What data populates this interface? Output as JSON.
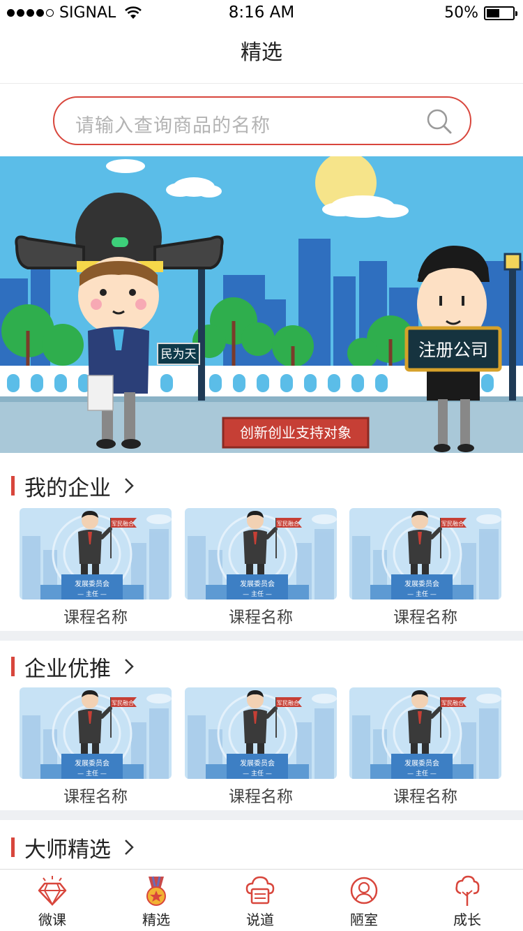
{
  "status": {
    "carrier": "SIGNAL",
    "time": "8:16 AM",
    "battery": "50%",
    "battery_level": 0.5
  },
  "nav": {
    "title": "精选"
  },
  "search": {
    "placeholder": "请输入查询商品的名称"
  },
  "banner": {
    "sign_left": "民为天",
    "sign_right": "注册公司",
    "caption": "创新创业支持对象"
  },
  "sections": [
    {
      "title": "我的企业",
      "items": [
        {
          "label": "课程名称",
          "flag": "军民融合",
          "podium_line1": "发展委员会",
          "podium_line2": "— 主任 —"
        },
        {
          "label": "课程名称",
          "flag": "军民融合",
          "podium_line1": "发展委员会",
          "podium_line2": "— 主任 —"
        },
        {
          "label": "课程名称",
          "flag": "军民融合",
          "podium_line1": "发展委员会",
          "podium_line2": "— 主任 —"
        }
      ]
    },
    {
      "title": "企业优推",
      "items": [
        {
          "label": "课程名称",
          "flag": "军民融合",
          "podium_line1": "发展委员会",
          "podium_line2": "— 主任 —"
        },
        {
          "label": "课程名称",
          "flag": "军民融合",
          "podium_line1": "发展委员会",
          "podium_line2": "— 主任 —"
        },
        {
          "label": "课程名称",
          "flag": "军民融合",
          "podium_line1": "发展委员会",
          "podium_line2": "— 主任 —"
        }
      ]
    },
    {
      "title": "大师精选"
    }
  ],
  "tabs": [
    {
      "label": "微课",
      "icon": "diamond-icon"
    },
    {
      "label": "精选",
      "icon": "medal-icon"
    },
    {
      "label": "说道",
      "icon": "cloud-message-icon"
    },
    {
      "label": "陋室",
      "icon": "person-icon"
    },
    {
      "label": "成长",
      "icon": "tree-icon"
    }
  ],
  "colors": {
    "accent": "#d8463c",
    "sky": "#5bbde8",
    "divider": "#eef0f3"
  }
}
